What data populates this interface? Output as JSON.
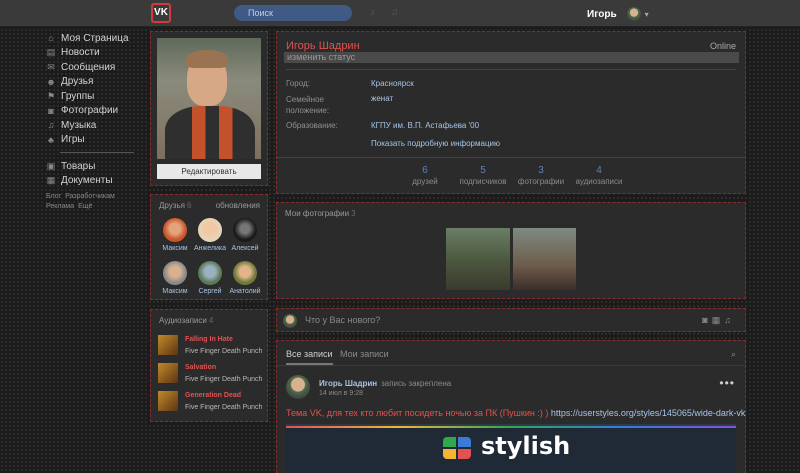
{
  "header": {
    "logo_text": "VK",
    "search_placeholder": "Поиск",
    "user_name": "Игорь"
  },
  "nav": {
    "items": [
      {
        "icon": "home-icon",
        "glyph": "⌂",
        "label": "Моя Страница"
      },
      {
        "icon": "news-icon",
        "glyph": "▤",
        "label": "Новости"
      },
      {
        "icon": "messages-icon",
        "glyph": "✉",
        "label": "Сообщения"
      },
      {
        "icon": "friends-icon",
        "glyph": "☻",
        "label": "Друзья"
      },
      {
        "icon": "groups-icon",
        "glyph": "⚑",
        "label": "Группы"
      },
      {
        "icon": "photos-icon",
        "glyph": "◙",
        "label": "Фотографии"
      },
      {
        "icon": "music-icon",
        "glyph": "♫",
        "label": "Музыка"
      },
      {
        "icon": "games-icon",
        "glyph": "♣",
        "label": "Игры"
      }
    ],
    "items2": [
      {
        "icon": "goods-icon",
        "glyph": "▣",
        "label": "Товары"
      },
      {
        "icon": "documents-icon",
        "glyph": "▦",
        "label": "Документы"
      }
    ],
    "footer_links": [
      "Блог",
      "Разработчикам",
      "Реклама",
      "Ещё"
    ]
  },
  "profile": {
    "edit_label": "Редактировать",
    "name": "Игорь Шадрин",
    "online": "Online",
    "status": "изменить статус",
    "fields": [
      {
        "label": "Город:",
        "value": "Красноярск"
      },
      {
        "label": "Семейное положение:",
        "value": "женат"
      },
      {
        "label": "Образование:",
        "value": "КГПУ им. В.П. Астафьева '00"
      }
    ],
    "show_more": "Показать подробную информацию",
    "counters": [
      {
        "num": "6",
        "label": "друзей"
      },
      {
        "num": "5",
        "label": "подписчиков"
      },
      {
        "num": "3",
        "label": "фотографии"
      },
      {
        "num": "4",
        "label": "аудиозаписи"
      }
    ]
  },
  "friends": {
    "title": "Друзья",
    "count": "6",
    "updates_label": "обновления",
    "list": [
      "Максим",
      "Анжелика",
      "Алексей",
      "Максим",
      "Сергей",
      "Анатолий"
    ]
  },
  "audio": {
    "title": "Аудиозаписи",
    "count": "4",
    "tracks": [
      {
        "title": "Falling In Hate",
        "artist": "Five Finger Death Punch"
      },
      {
        "title": "Salvation",
        "artist": "Five Finger Death Punch"
      },
      {
        "title": "Generation Dead",
        "artist": "Five Finger Death Punch"
      }
    ]
  },
  "photos": {
    "title": "Мои фотографии",
    "count": "3"
  },
  "newpost": {
    "placeholder": "Что у Вас нового?"
  },
  "wall": {
    "tabs": [
      "Все записи",
      "Мои записи"
    ],
    "post": {
      "author": "Игорь Шадрин",
      "pinned": "запись закреплена",
      "date": "14 июл в 9:28",
      "text": "Тема VK, для тех кто любит посидеть ночью за ПК (Пушкин :) )",
      "link": "https://userstyles.org/styles/145065/wide-dark-vk",
      "card_title": "stylish"
    }
  },
  "colors": {
    "accent_red": "#e35151",
    "link_blue": "#a6c4e8",
    "panel_bg": "#2b2b2b",
    "page_bg": "#1b1b1b"
  }
}
